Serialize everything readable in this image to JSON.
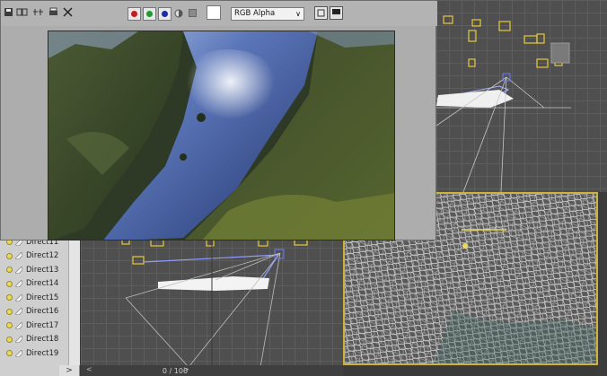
{
  "render_window": {
    "channel_select": {
      "value": "RGB Alpha"
    },
    "toolbar_icons": [
      "save-icon",
      "clone-icon",
      "print-icon",
      "clear-icon"
    ],
    "rgb_buttons": [
      {
        "name": "red-channel",
        "color": "#c41c1c"
      },
      {
        "name": "green-channel",
        "color": "#1f9a2e"
      },
      {
        "name": "blue-channel",
        "color": "#1c2aa8"
      }
    ]
  },
  "scene_list": {
    "items": [
      "Direct11",
      "Direct12",
      "Direct13",
      "Direct14",
      "Direct15",
      "Direct16",
      "Direct17",
      "Direct18",
      "Direct19"
    ]
  },
  "timeline": {
    "frame_counter": "0 / 100"
  },
  "colors": {
    "active_viewport_border": "#cfb23a",
    "lamp": "#e8d960"
  }
}
